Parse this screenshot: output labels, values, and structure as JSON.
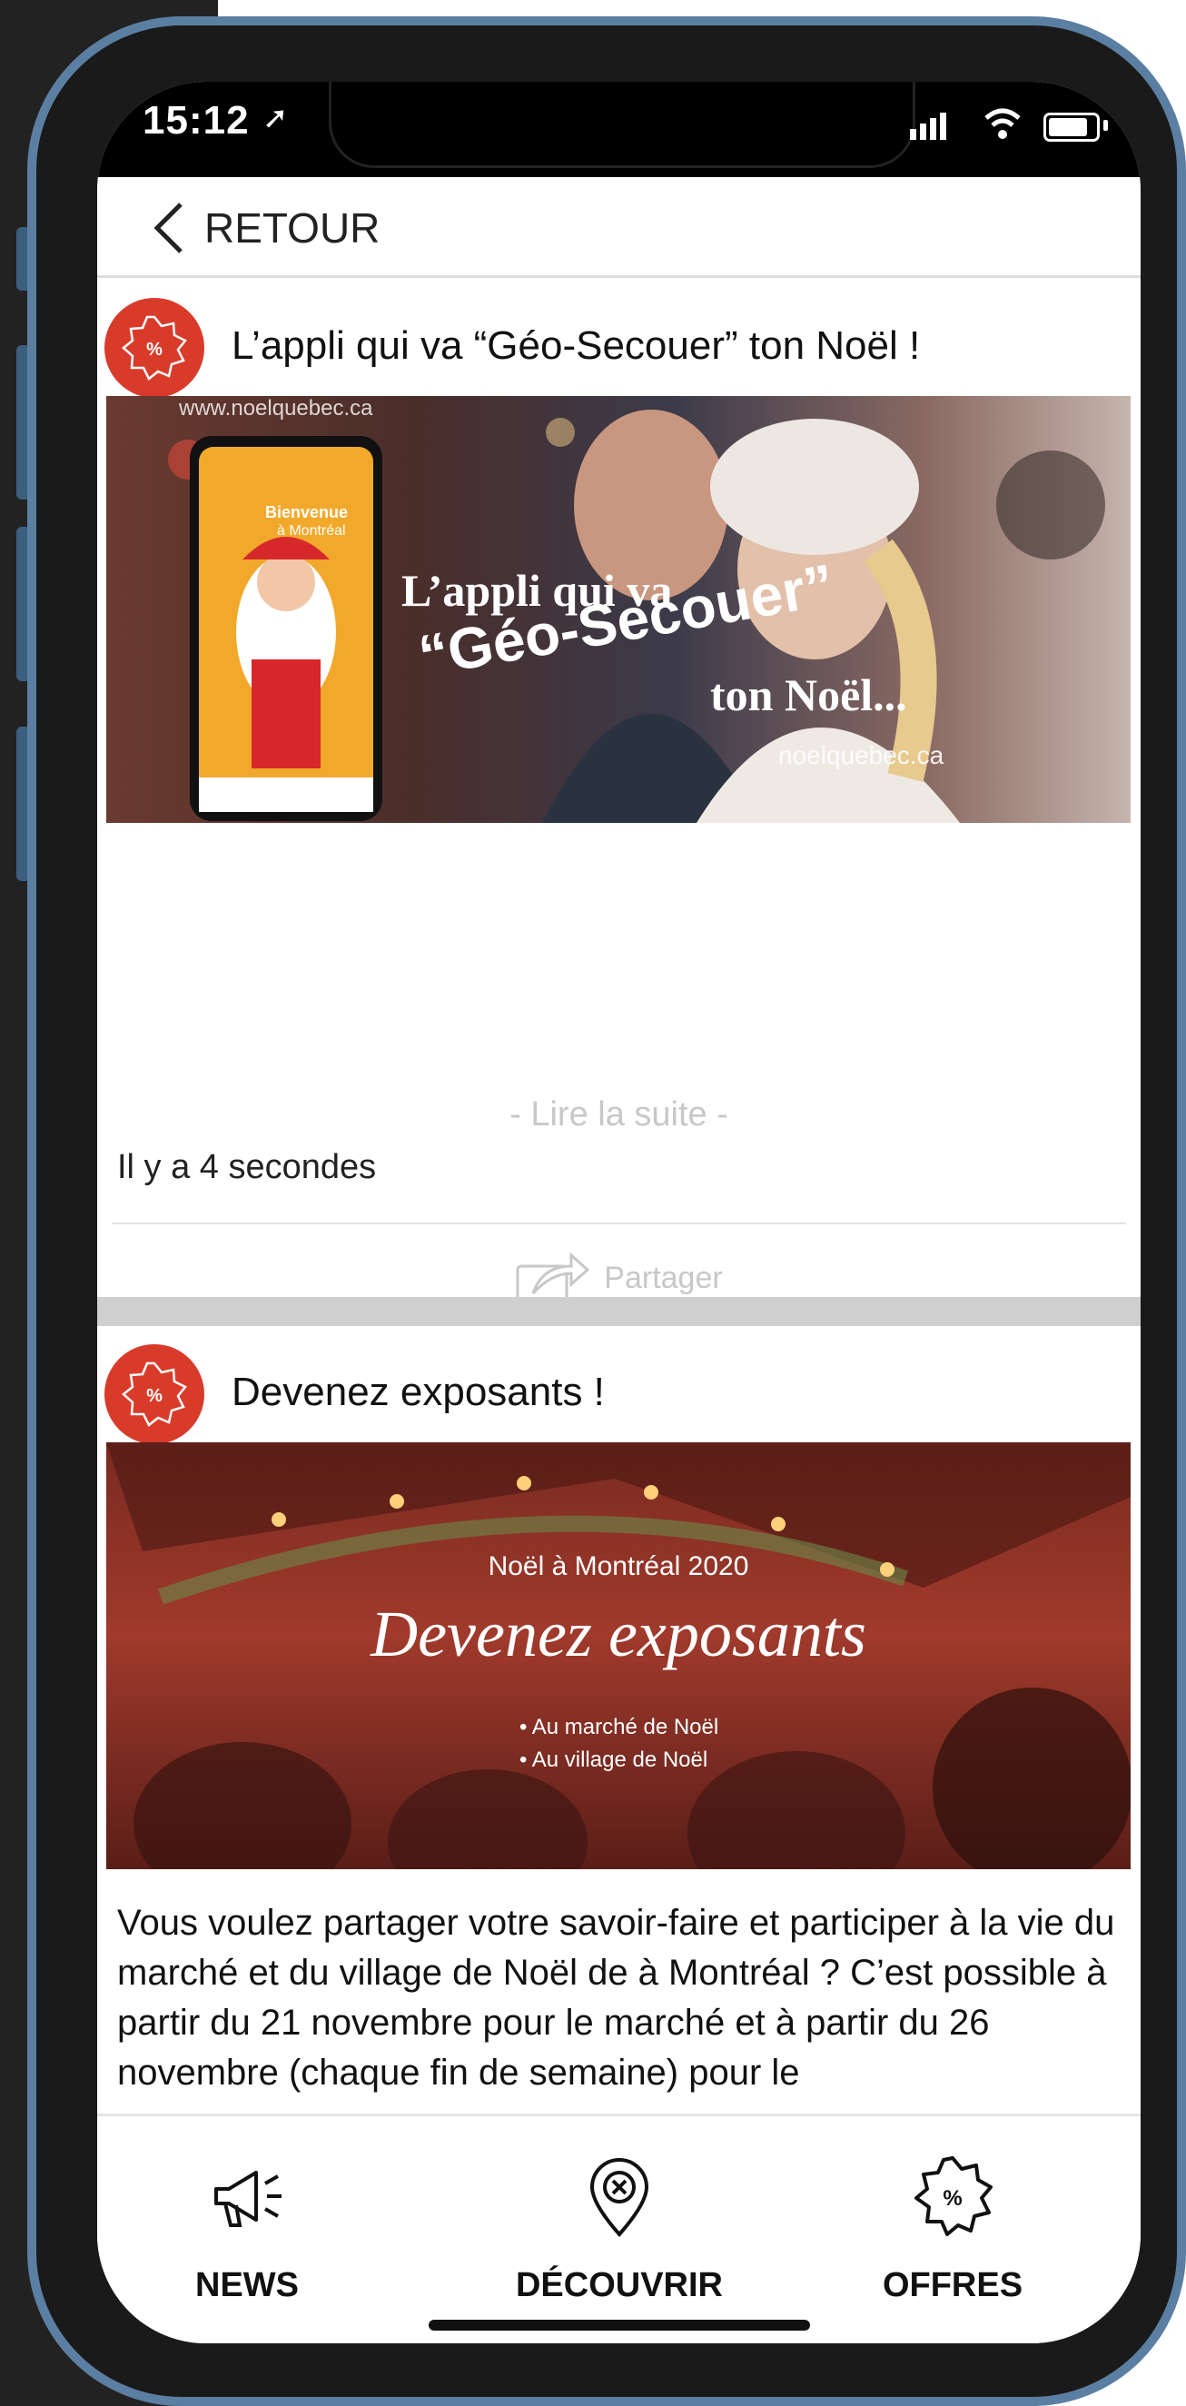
{
  "status_bar": {
    "time": "15:12"
  },
  "header": {
    "back_label": "RETOUR"
  },
  "posts": [
    {
      "title": "L’appli qui va “Géo-Secouer” ton Noël !",
      "banner": {
        "watermark": "www.noelquebec.ca",
        "phone_text_1": "Bienvenue",
        "phone_text_2": "à Montréal",
        "headline_1": "L’appli qui va",
        "headline_2": "“Géo-Secouer”",
        "headline_3": "ton Noël...",
        "site": "noelquebec.ca"
      },
      "read_more": "- Lire la suite -",
      "time_ago": "Il y a 4 secondes",
      "share_label": "Partager"
    },
    {
      "title": "Devenez exposants !",
      "banner": {
        "subtitle": "Noël à Montréal 2020",
        "headline": "Devenez exposants",
        "bullet_1": "• Au marché de Noël",
        "bullet_2": "• Au village de Noël"
      },
      "description": "Vous voulez partager votre savoir-faire et participer à la vie du marché et du village de Noël de à Montréal ? C’est possible à partir du 21 novembre pour le marché et à partir du 26 novembre (chaque fin de semaine) pour le"
    }
  ],
  "nav": {
    "news": "NEWS",
    "discover": "DÉCOUVRIR",
    "offers": "OFFRES"
  },
  "colors": {
    "badge_red": "#d93b2b",
    "frame_blue": "#5b7fa2"
  }
}
